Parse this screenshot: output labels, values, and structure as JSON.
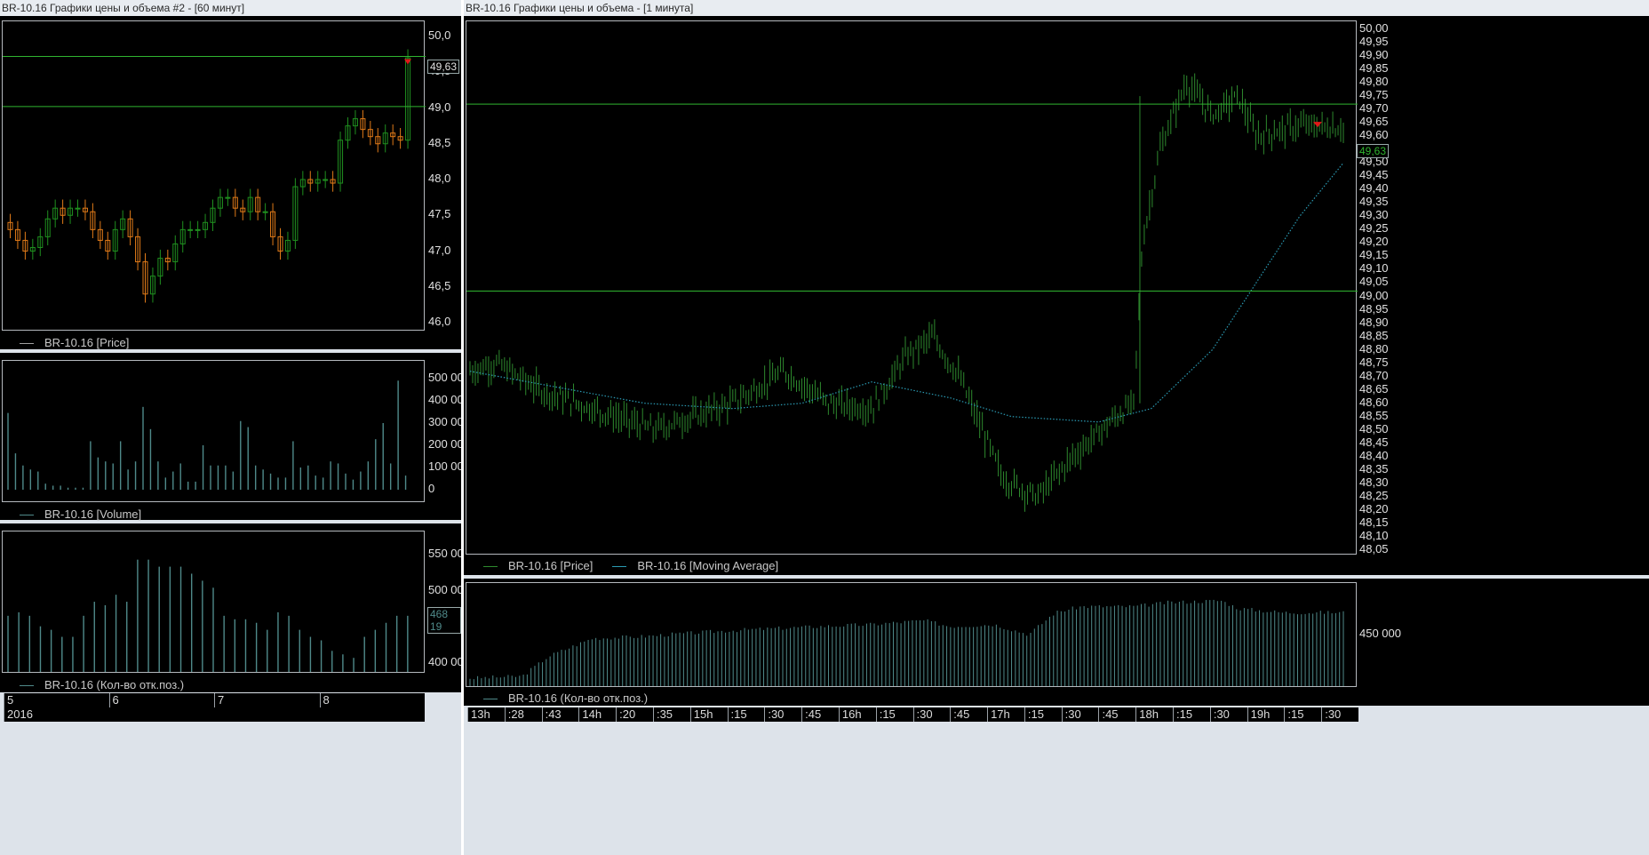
{
  "left_window": {
    "title": "BR-10.16 Графики цены и объема #2 - [60 минут]",
    "price_legend": "BR-10.16 [Price]",
    "volume_legend": "BR-10.16 [Volume]",
    "oi_legend": "BR-10.16 (Кол-во отк.поз.)",
    "last_price": "49,63",
    "oi_last_value": "468 19",
    "date_axis_top": [
      "5",
      "6",
      "7",
      "8"
    ],
    "date_axis_bottom": [
      "2016"
    ],
    "price_ticks": [
      "50,0",
      "49,5",
      "49,0",
      "48,5",
      "48,0",
      "47,5",
      "47,0",
      "46,5",
      "46,0"
    ],
    "volume_ticks": [
      "500 00",
      "400 00",
      "300 00",
      "200 00",
      "100 00",
      "0"
    ],
    "oi_ticks": [
      "550 00",
      "500 00",
      "450 00",
      "400 00"
    ],
    "level_lines": [
      49.72,
      49.02
    ]
  },
  "right_window": {
    "title": "BR-10.16 Графики цены и объема - [1 минута]",
    "price_legend": "BR-10.16 [Price]",
    "ma_legend": "BR-10.16 [Moving Average]",
    "oi_legend": "BR-10.16 (Кол-во отк.поз.)",
    "last_price": "49,63",
    "price_ticks": [
      "50,00",
      "49,95",
      "49,90",
      "49,85",
      "49,80",
      "49,75",
      "49,70",
      "49,65",
      "49,60",
      "49,55",
      "49,50",
      "49,45",
      "49,40",
      "49,35",
      "49,30",
      "49,25",
      "49,20",
      "49,15",
      "49,10",
      "49,05",
      "49,00",
      "48,95",
      "48,90",
      "48,85",
      "48,80",
      "48,75",
      "48,70",
      "48,65",
      "48,60",
      "48,55",
      "48,50",
      "48,45",
      "48,40",
      "48,35",
      "48,30",
      "48,25",
      "48,20",
      "48,15",
      "48,10",
      "48,05"
    ],
    "oi_ticks": [
      "450 000"
    ],
    "time_axis": [
      "13h",
      ":28",
      ":43",
      "14h",
      ":20",
      ":35",
      "15h",
      ":15",
      ":30",
      ":45",
      "16h",
      ":15",
      ":30",
      ":45",
      "17h",
      ":15",
      ":30",
      ":45",
      "18h",
      ":15",
      ":30",
      "19h",
      ":15",
      ":30"
    ],
    "level_lines": [
      49.72,
      49.02
    ]
  },
  "colors": {
    "up": "#1f8f1f",
    "down": "#e07a18",
    "bar1m": "#2e8a2e",
    "volume": "#4f8a8a",
    "ma": "#2a9ab3",
    "level": "#2fb42f",
    "marker": "#e01818"
  },
  "chart_data": [
    {
      "type": "candlestick",
      "x": [
        "5",
        "6",
        "7",
        "8"
      ],
      "ylim": [
        46.0,
        50.0
      ],
      "hourly_closes": [
        47.3,
        47.15,
        47.0,
        47.05,
        47.2,
        47.45,
        47.6,
        47.5,
        47.6,
        47.6,
        47.55,
        47.3,
        47.15,
        47.0,
        47.3,
        47.45,
        47.2,
        46.85,
        46.4,
        46.65,
        46.9,
        46.85,
        47.1,
        47.3,
        47.3,
        47.3,
        47.4,
        47.6,
        47.75,
        47.75,
        47.6,
        47.55,
        47.75,
        47.55,
        47.55,
        47.2,
        47.0,
        47.15,
        47.9,
        48.0,
        47.95,
        48.0,
        48.0,
        47.95,
        48.55,
        48.75,
        48.85,
        48.7,
        48.6,
        48.5,
        48.65,
        48.6,
        48.55,
        49.7
      ],
      "volume_ylim": [
        0,
        550000
      ],
      "volume": [
        380000,
        180000,
        120000,
        100000,
        90000,
        30000,
        20000,
        20000,
        10000,
        10000,
        10000,
        240000,
        160000,
        140000,
        130000,
        240000,
        100000,
        140000,
        410000,
        300000,
        140000,
        60000,
        90000,
        130000,
        40000,
        40000,
        220000,
        120000,
        120000,
        120000,
        90000,
        340000,
        310000,
        120000,
        100000,
        80000,
        60000,
        60000,
        240000,
        110000,
        120000,
        70000,
        60000,
        140000,
        130000,
        80000,
        50000,
        90000,
        140000,
        250000,
        330000,
        130000,
        540000,
        70000
      ],
      "oi_ylim": [
        390000,
        580000
      ],
      "open_interest": [
        470000,
        475000,
        470000,
        455000,
        450000,
        440000,
        440000,
        470000,
        490000,
        485000,
        500000,
        490000,
        550000,
        550000,
        540000,
        540000,
        540000,
        530000,
        520000,
        510000,
        470000,
        465000,
        465000,
        460000,
        450000,
        475000,
        470000,
        450000,
        440000,
        435000,
        420000,
        415000,
        410000,
        440000,
        450000,
        460000,
        470000,
        470000
      ]
    },
    {
      "type": "bar",
      "x": [
        "13h",
        "14h",
        "15h",
        "16h",
        "17h",
        "18h",
        "19h"
      ],
      "ylim": [
        48.05,
        50.0
      ],
      "minute_price_path": [
        [
          0,
          48.72
        ],
        [
          0.03,
          48.75
        ],
        [
          0.08,
          48.65
        ],
        [
          0.14,
          48.58
        ],
        [
          0.21,
          48.5
        ],
        [
          0.3,
          48.6
        ],
        [
          0.36,
          48.72
        ],
        [
          0.41,
          48.6
        ],
        [
          0.46,
          48.58
        ],
        [
          0.5,
          48.78
        ],
        [
          0.53,
          48.85
        ],
        [
          0.56,
          48.7
        ],
        [
          0.61,
          48.32
        ],
        [
          0.65,
          48.25
        ],
        [
          0.69,
          48.4
        ],
        [
          0.74,
          48.55
        ],
        [
          0.76,
          48.6
        ],
        [
          0.77,
          49.2
        ],
        [
          0.79,
          49.55
        ],
        [
          0.82,
          49.8
        ],
        [
          0.85,
          49.68
        ],
        [
          0.88,
          49.75
        ],
        [
          0.9,
          49.6
        ],
        [
          0.95,
          49.64
        ],
        [
          1.0,
          49.63
        ]
      ],
      "moving_average_path": [
        [
          0,
          48.72
        ],
        [
          0.2,
          48.6
        ],
        [
          0.3,
          48.58
        ],
        [
          0.38,
          48.6
        ],
        [
          0.46,
          48.68
        ],
        [
          0.55,
          48.62
        ],
        [
          0.62,
          48.55
        ],
        [
          0.72,
          48.53
        ],
        [
          0.78,
          48.58
        ],
        [
          0.85,
          48.8
        ],
        [
          0.9,
          49.05
        ],
        [
          0.95,
          49.3
        ],
        [
          1.0,
          49.5
        ]
      ],
      "open_interest_ylim": [
        435000,
        468000
      ]
    }
  ]
}
